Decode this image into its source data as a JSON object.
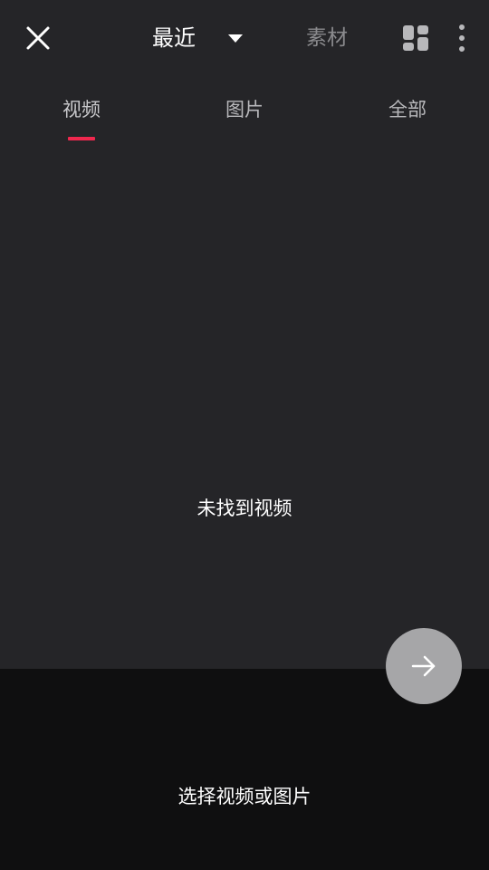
{
  "header": {
    "album_label": "最近",
    "material_label": "素材",
    "icons": {
      "close": "close-icon",
      "dropdown": "caret-down-icon",
      "layout": "grid-layout-icon",
      "more": "more-vertical-icon"
    }
  },
  "tabs": [
    {
      "label": "视频",
      "active": true
    },
    {
      "label": "图片",
      "active": false
    },
    {
      "label": "全部",
      "active": false
    }
  ],
  "empty_state": {
    "message": "未找到视频"
  },
  "bottom_panel": {
    "hint": "选择视频或图片"
  },
  "next_button": {
    "icon": "arrow-right-icon"
  },
  "colors": {
    "background": "#252528",
    "bottom_panel": "#0f0f10",
    "accent": "#f0284e",
    "next_button": "#a6a6a8",
    "muted_text": "#8a8a8d"
  }
}
